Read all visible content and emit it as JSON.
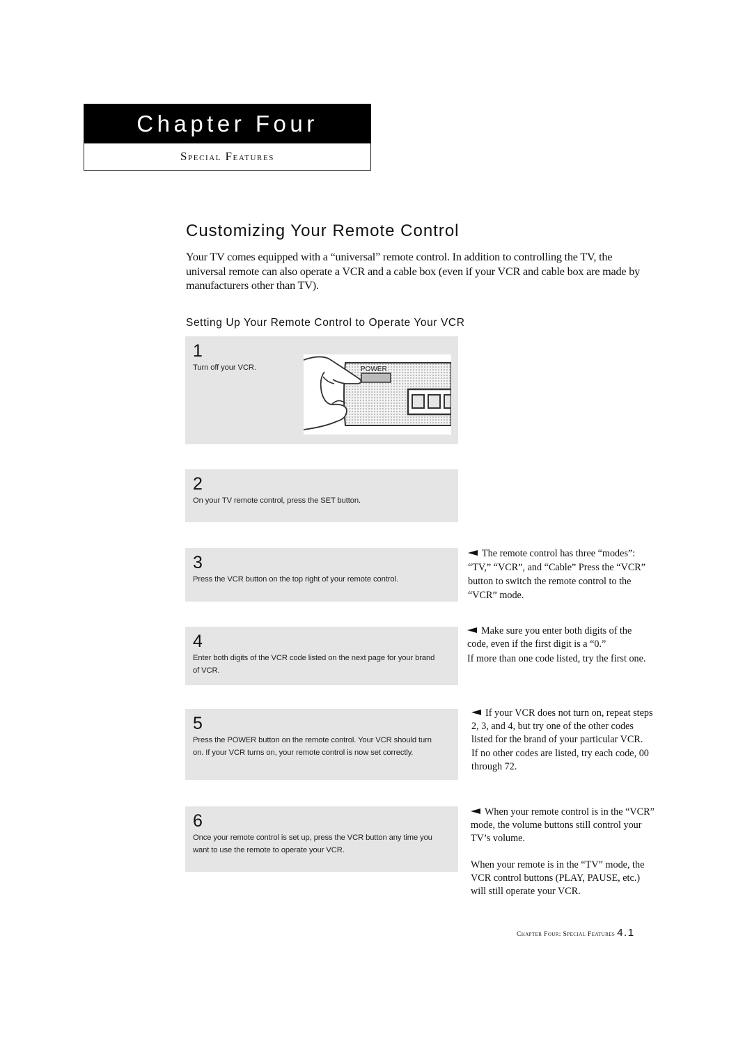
{
  "chapter": {
    "title": "Chapter Four",
    "subtitle_initial_1": "S",
    "subtitle_rest_1": "pecial ",
    "subtitle_initial_2": "F",
    "subtitle_rest_2": "eatures"
  },
  "section": {
    "title": "Customizing Your Remote Control",
    "intro": "Your TV comes equipped with a “universal” remote control. In addition to controlling the TV,  the universal remote can also operate a VCR and a cable box (even if your VCR and cable box are made by manufacturers other than TV).",
    "subsection_title": "Setting Up Your Remote Control to Operate Your VCR"
  },
  "steps": [
    {
      "number": "1",
      "text": "Turn off your VCR."
    },
    {
      "number": "2",
      "text": "On your TV remote control, press the SET button."
    },
    {
      "number": "3",
      "text": "Press the VCR button on the top right of your remote control."
    },
    {
      "number": "4",
      "text": "Enter both digits of the VCR code listed on the next page for your brand of VCR."
    },
    {
      "number": "5",
      "text": "Press the POWER button on the remote control. Your VCR should turn on. If your VCR turns on, your remote control is now set correctly."
    },
    {
      "number": "6",
      "text": "Once your remote control is set up, press the VCR button any time you want to use the remote to operate your VCR."
    }
  ],
  "illustration": {
    "label": "POWER",
    "icon": "hand-pressing-power-button-icon"
  },
  "notes": [
    {
      "text": "The remote control has three “modes”: “TV,”  “VCR”,  and “Cable” Press the “VCR” button to switch the remote control to the “VCR” mode.",
      "extra": ""
    },
    {
      "text": "Make sure you enter both digits of the code, even if the first digit is a “0.”",
      "extra": "If more than one code listed, try the first one."
    },
    {
      "text": "If your VCR does not turn on, repeat steps 2, 3, and 4, but try one of the other codes listed for the brand of your particular VCR.",
      "extra": "If no other codes are listed, try each code, 00 through 72."
    },
    {
      "text": "When your remote control is in the “VCR” mode, the volume buttons still control your TV’s volume.",
      "extra": "When your remote is in the “TV” mode, the VCR control buttons (PLAY, PAUSE, etc.) will still operate your VCR."
    }
  ],
  "footer": {
    "label": "Chapter Four: Special Features",
    "page": "4.1"
  }
}
